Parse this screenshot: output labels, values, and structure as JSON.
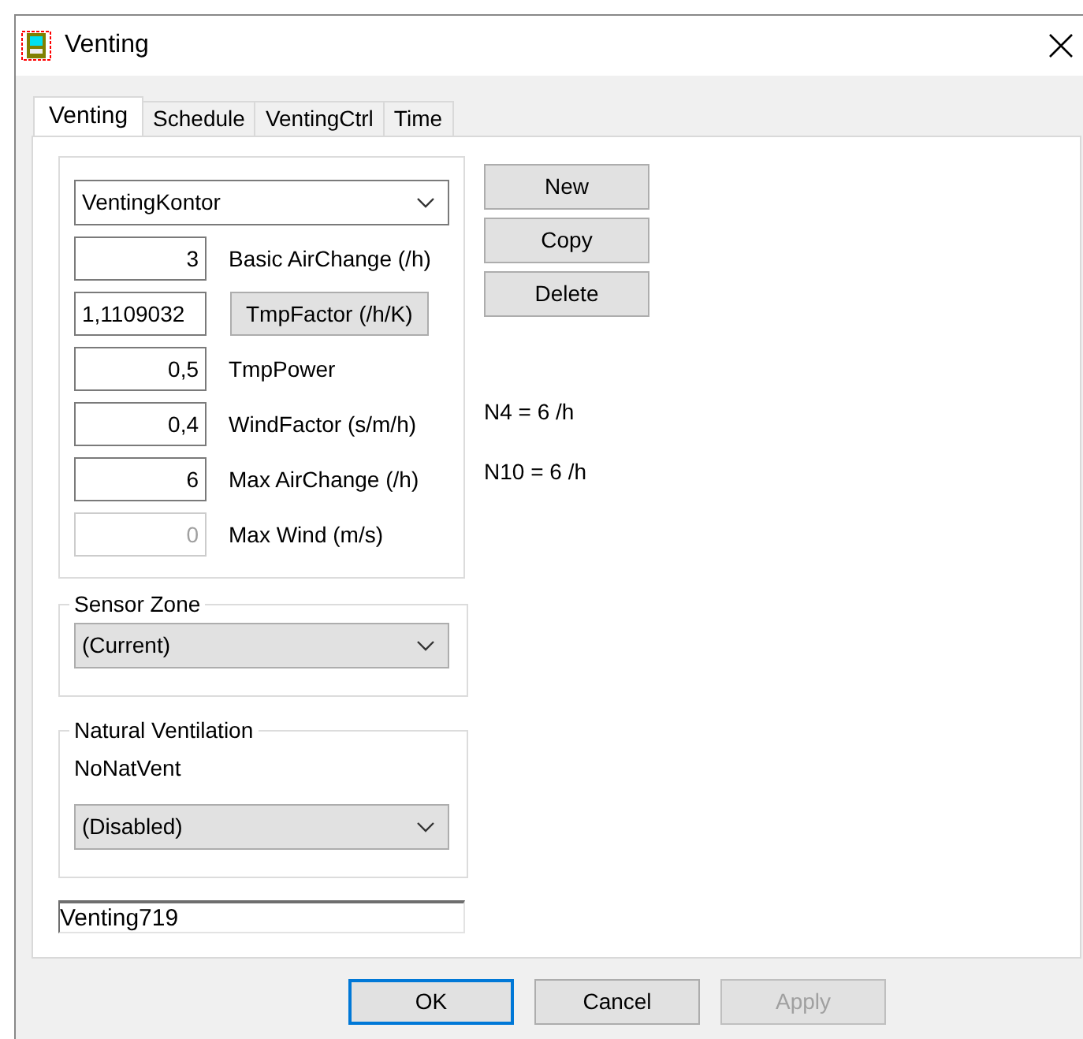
{
  "window": {
    "title": "Venting"
  },
  "tabs": [
    {
      "label": "Venting",
      "selected": true
    },
    {
      "label": "Schedule",
      "selected": false
    },
    {
      "label": "VentingCtrl",
      "selected": false
    },
    {
      "label": "Time",
      "selected": false
    }
  ],
  "profile_select": {
    "value": "VentingKontor"
  },
  "parameters": [
    {
      "value": "3",
      "label": "Basic AirChange (/h)",
      "kind": "text",
      "disabled": false
    },
    {
      "value": "1,1109032",
      "label": "TmpFactor (/h/K)",
      "kind": "button",
      "disabled": false
    },
    {
      "value": "0,5",
      "label": "TmpPower",
      "kind": "text",
      "disabled": false
    },
    {
      "value": "0,4",
      "label": "WindFactor (s/m/h)",
      "kind": "text",
      "disabled": false
    },
    {
      "value": "6",
      "label": "Max AirChange (/h)",
      "kind": "text",
      "disabled": false
    },
    {
      "value": "0",
      "label": "Max Wind (m/s)",
      "kind": "text",
      "disabled": true
    }
  ],
  "side_buttons": [
    "New",
    "Copy",
    "Delete"
  ],
  "readouts": [
    "N4 = 6 /h",
    "N10 = 6 /h"
  ],
  "sensor_zone": {
    "title": "Sensor Zone",
    "value": "(Current)"
  },
  "natural_ventilation": {
    "title": "Natural Ventilation",
    "label": "NoNatVent",
    "value": "(Disabled)"
  },
  "name_field": {
    "value": "Venting719"
  },
  "buttons": [
    {
      "label": "OK",
      "kind": "default",
      "disabled": false
    },
    {
      "label": "Cancel",
      "kind": "normal",
      "disabled": false
    },
    {
      "label": "Apply",
      "kind": "normal",
      "disabled": true
    }
  ]
}
